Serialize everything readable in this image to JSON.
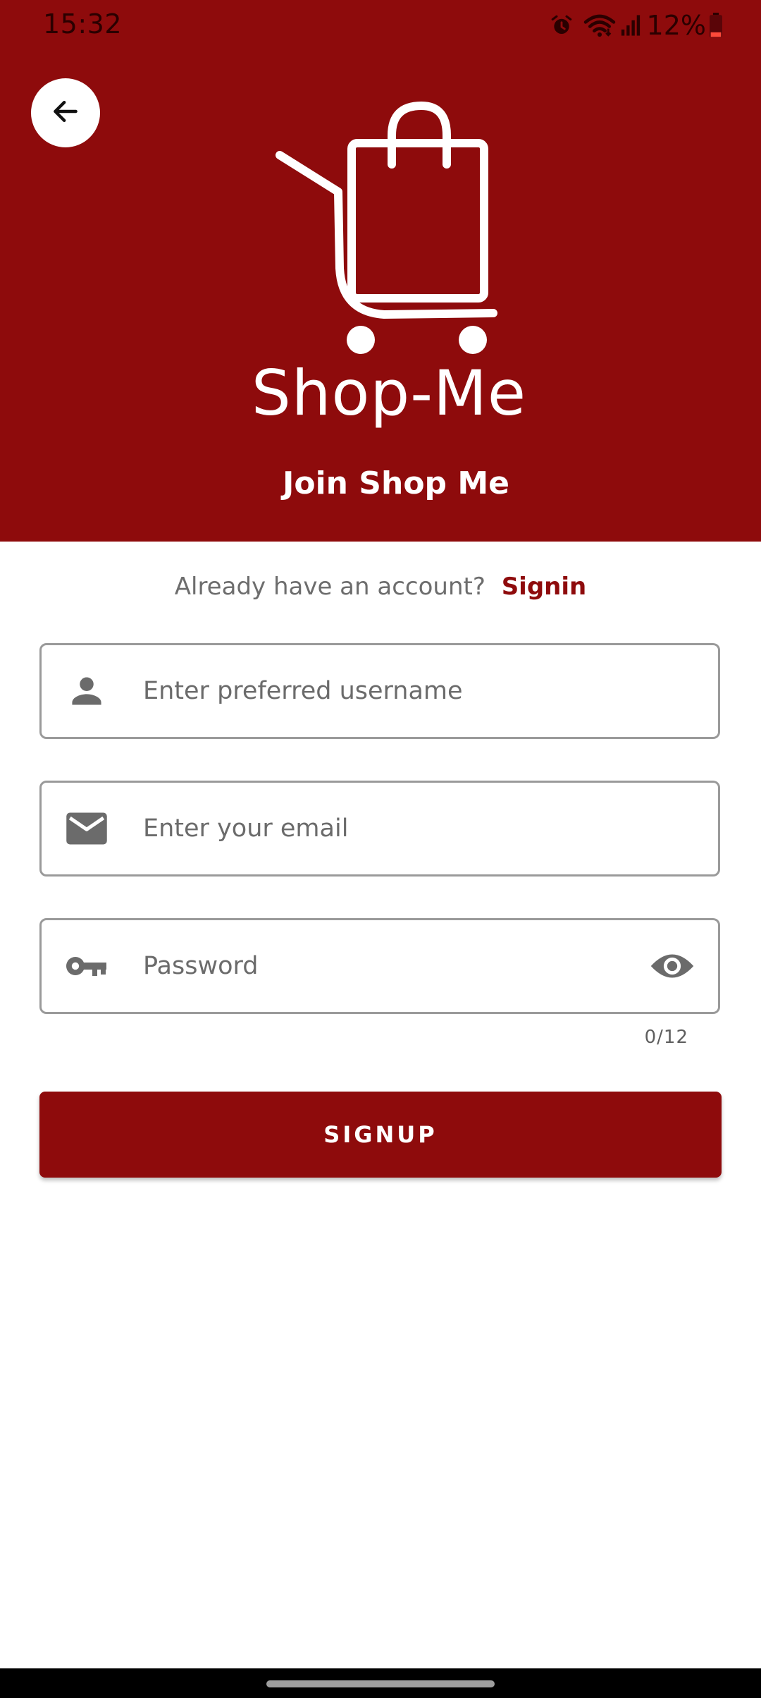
{
  "status_bar": {
    "time": "15:32",
    "battery": "12%",
    "icons": [
      "alarm-icon",
      "wifi-icon",
      "signal-icon",
      "battery-icon"
    ]
  },
  "header": {
    "brand_name": "Shop-Me",
    "title": "Join Shop Me",
    "logo_icon": "shopping-cart-bag-icon",
    "background_color": "#8e0b0c"
  },
  "signin_prompt": {
    "text": "Already have an account?",
    "link_label": "Signin"
  },
  "form": {
    "username": {
      "placeholder": "Enter preferred username",
      "value": "",
      "icon": "person-icon"
    },
    "email": {
      "placeholder": "Enter your email",
      "value": "",
      "icon": "mail-icon"
    },
    "password": {
      "placeholder": "Password",
      "value": "",
      "icon": "key-icon",
      "toggle_icon": "eye-icon",
      "counter": "0/12"
    }
  },
  "signup_button": {
    "label": "SIGNUP"
  },
  "colors": {
    "accent": "#8e0b0c",
    "input_border": "#9a9a9a",
    "icon": "#6b6b6b"
  }
}
